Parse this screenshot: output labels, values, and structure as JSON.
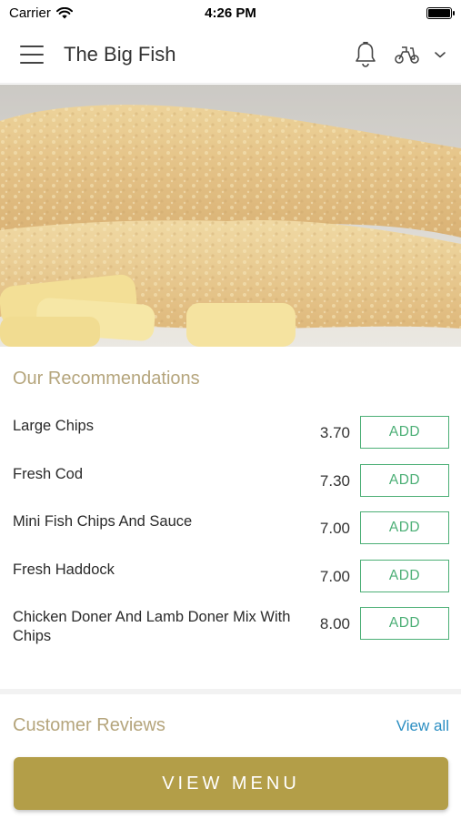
{
  "status_bar": {
    "carrier": "Carrier",
    "time": "4:26 PM"
  },
  "header": {
    "title": "The Big Fish",
    "icons": [
      "menu-icon",
      "bell-icon",
      "scooter-icon",
      "chevron-down-icon"
    ]
  },
  "recommendations": {
    "title": "Our Recommendations",
    "items": [
      {
        "name": "Large Chips",
        "price": "3.70",
        "add_label": "ADD"
      },
      {
        "name": "Fresh Cod",
        "price": "7.30",
        "add_label": "ADD"
      },
      {
        "name": "Mini Fish Chips And Sauce",
        "price": "7.00",
        "add_label": "ADD"
      },
      {
        "name": "Fresh Haddock",
        "price": "7.00",
        "add_label": "ADD"
      },
      {
        "name": "Chicken Doner And Lamb Doner Mix With Chips",
        "price": "8.00",
        "add_label": "ADD"
      }
    ]
  },
  "reviews": {
    "title": "Customer Reviews",
    "view_all_label": "View all"
  },
  "footer": {
    "view_menu_label": "VIEW MENU"
  },
  "colors": {
    "accent_gold": "#b39e48",
    "section_title": "#b5a57c",
    "add_green": "#4caf76",
    "link_blue": "#2b8ec2"
  }
}
